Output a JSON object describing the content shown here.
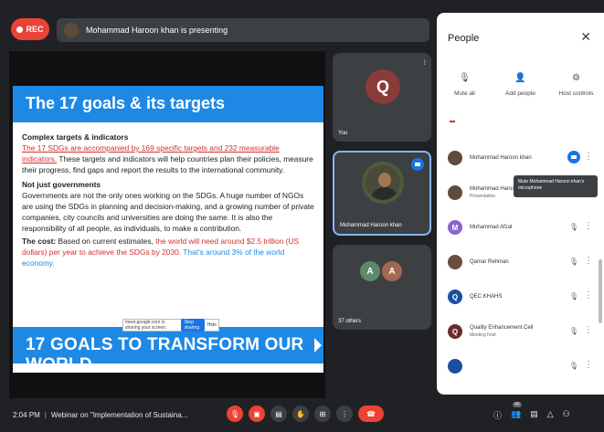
{
  "topbar": {
    "rec_label": "REC",
    "presenting_text": "Mohammad Haroon khan is presenting"
  },
  "slide": {
    "title": "The 17 goals & its targets",
    "h1": "Complex targets & indicators",
    "p1_red": "The 17 SDGs are accompanied by 169 specific targets and 232 measurable indicators.",
    "p1_rest": "These targets and indicators will help countries plan their policies, measure their progress, find gaps and report the results to the international community.",
    "h2": "Not just governments",
    "p2": "Governments are not the only ones working on the SDGs. A huge number of NGOs are using the SDGs in planning and decision-making, and a growing number of private companies, city councils and universities are doing the same. It is also the responsibility of all people, as individuals, to make a contribution.",
    "cost_label": "The cost:",
    "cost_text": " Based on current estimates, ",
    "cost_red": "the world will need around $2.5 trillion (US dollars) per year to achieve the SDGs by 2030.",
    "cost_blue": " That's around 3% of the world economy.",
    "banner": "17 GOALS TO TRANSFORM OUR WORLD",
    "popup_text": "meet.google.com is sharing your screen.",
    "popup_button": "Stop sharing",
    "popup_hide": "Hide"
  },
  "tiles": {
    "you_initial": "Q",
    "you_label": "You",
    "presenter_label": "Mohammad Haroon khan",
    "others_a": "A",
    "others_b": "A",
    "others_label": "37 others"
  },
  "panel": {
    "title": "People",
    "close": "✕",
    "actions": [
      {
        "icon": "mic-off-icon",
        "glyph": "🎙",
        "label": "Mute all"
      },
      {
        "icon": "add-person-icon",
        "glyph": "👤",
        "label": "Add people"
      },
      {
        "icon": "host-controls-icon",
        "glyph": "⚙",
        "label": "Host controls"
      }
    ],
    "tooltip": "Mute Mohammad Haroon khan's microphone",
    "people": [
      {
        "name": "Mohammad Haroon khan",
        "sub": "",
        "initial": "",
        "color": "#5f4b3b",
        "mic": "active"
      },
      {
        "name": "Mohammad Haroon khan",
        "sub": "Presentation",
        "initial": "",
        "color": "#5f4b3b",
        "mic": "none"
      },
      {
        "name": "Muhammad Afzal",
        "sub": "",
        "initial": "M",
        "color": "#8e63ce",
        "mic": "off"
      },
      {
        "name": "Qamar Rehman",
        "sub": "",
        "initial": "",
        "color": "#6d4c41",
        "mic": "off"
      },
      {
        "name": "QEC KHAHS",
        "sub": "",
        "initial": "Q",
        "color": "#1a4fa0",
        "mic": "off"
      },
      {
        "name": "Quality Enhancement Cell",
        "sub": "Meeting host",
        "initial": "Q",
        "color": "#6b2b2b",
        "mic": "off"
      },
      {
        "name": "",
        "sub": "",
        "initial": "",
        "color": "#1a4fa0",
        "mic": "off"
      }
    ]
  },
  "bottombar": {
    "time": "2:04 PM",
    "meeting_title": "Webinar on \"Implementation of Sustaina..."
  }
}
